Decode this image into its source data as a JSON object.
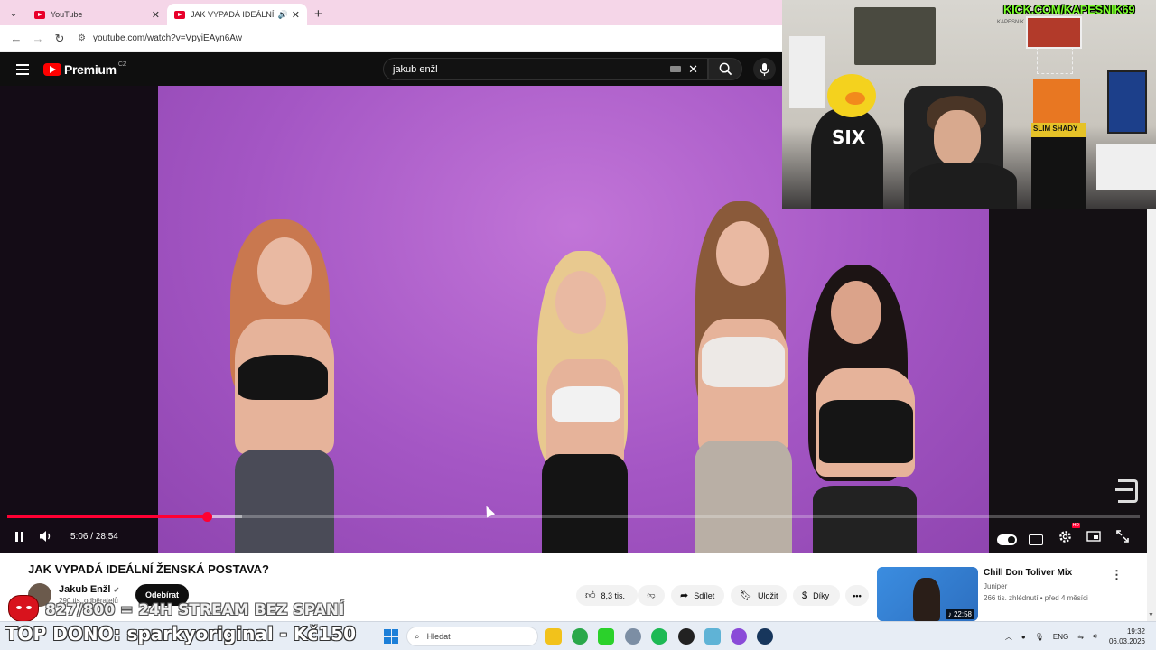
{
  "browser": {
    "tabs": [
      {
        "label": "YouTube",
        "active": false
      },
      {
        "label": "JAK VYPADÁ IDEÁLNÍ ŽENSKÁ",
        "active": true
      }
    ],
    "url": "youtube.com/watch?v=VpyiEAyn6Aw"
  },
  "youtube": {
    "logo_text": "Premium",
    "logo_region": "CZ",
    "search_query": "jakub enžl"
  },
  "player": {
    "current_time": "5:06",
    "duration": "28:54",
    "time_display": "5:06 / 28:54",
    "progress_fraction": 0.1765,
    "buffered_fraction": 0.2075
  },
  "video": {
    "title": "JAK VYPADÁ IDEÁLNÍ ŽENSKÁ POSTAVA?",
    "channel_name": "Jakub Enžl",
    "subscribers": "290 tis. odběratelů",
    "subscribe_label": "Odebírat",
    "likes": "8,3 tis.",
    "share_label": "Sdílet",
    "save_label": "Uložit",
    "thanks_label": "Díky"
  },
  "recommendation": {
    "title": "Chill Don Toliver Mix",
    "channel": "Juniper",
    "meta": "266 tis. zhlédnutí • před 4 měsíci",
    "duration": "22:58"
  },
  "stream_overlay": {
    "kick_handle": "KICK.COM/KAPESNIK69",
    "goal_text": "827/800 = 24H STREAM BEZ SPANÍ",
    "top_dono": "TOP DONO: sparkyoriginal - Kč150",
    "hoodie_text": "SIX",
    "poster_text": "SLIM SHADY"
  },
  "taskbar": {
    "search_placeholder": "Hledat",
    "language": "ENG",
    "time": "19:32",
    "date": "06.03.2026"
  },
  "colors": {
    "yt_red": "#ff0033",
    "video_bg": "#a456c4",
    "kick_green": "#7cff2c"
  }
}
